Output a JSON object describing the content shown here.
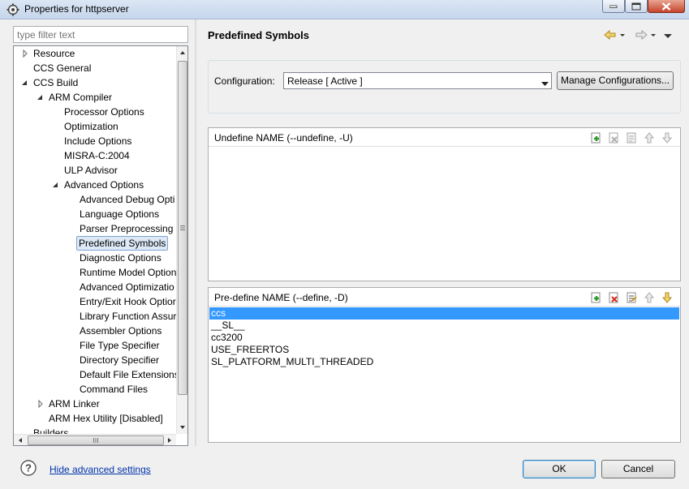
{
  "window": {
    "title": "Properties for httpserver",
    "icons": {
      "app": "properties-icon",
      "min": "minimize-icon",
      "max": "maximize-icon",
      "close": "close-icon"
    }
  },
  "filter": {
    "placeholder": "type filter text"
  },
  "tree": {
    "items": [
      {
        "label": "Resource",
        "expander": "collapsed"
      },
      {
        "label": "CCS General",
        "expander": "none"
      },
      {
        "label": "CCS Build",
        "expander": "expanded"
      },
      {
        "label": "ARM Compiler",
        "expander": "expanded"
      },
      {
        "label": "Processor Options",
        "expander": "none"
      },
      {
        "label": "Optimization",
        "expander": "none"
      },
      {
        "label": "Include Options",
        "expander": "none"
      },
      {
        "label": "MISRA-C:2004",
        "expander": "none"
      },
      {
        "label": "ULP Advisor",
        "expander": "none"
      },
      {
        "label": "Advanced Options",
        "expander": "expanded"
      },
      {
        "label": "Advanced Debug Opti",
        "expander": "none"
      },
      {
        "label": "Language Options",
        "expander": "none"
      },
      {
        "label": "Parser Preprocessing C",
        "expander": "none"
      },
      {
        "label": "Predefined Symbols",
        "expander": "none",
        "selected": true
      },
      {
        "label": "Diagnostic Options",
        "expander": "none"
      },
      {
        "label": "Runtime Model Option",
        "expander": "none"
      },
      {
        "label": "Advanced Optimizatio",
        "expander": "none"
      },
      {
        "label": "Entry/Exit Hook Optior",
        "expander": "none"
      },
      {
        "label": "Library Function Assur",
        "expander": "none"
      },
      {
        "label": "Assembler Options",
        "expander": "none"
      },
      {
        "label": "File Type Specifier",
        "expander": "none"
      },
      {
        "label": "Directory Specifier",
        "expander": "none"
      },
      {
        "label": "Default File Extensions",
        "expander": "none"
      },
      {
        "label": "Command Files",
        "expander": "none"
      },
      {
        "label": "ARM Linker",
        "expander": "collapsed"
      },
      {
        "label": "ARM Hex Utility  [Disabled]",
        "expander": "none"
      },
      {
        "label": "Builders",
        "expander": "none"
      }
    ]
  },
  "page": {
    "title": "Predefined Symbols",
    "nav": {
      "back": "back-arrow-icon",
      "forward": "forward-arrow-icon",
      "menu": "view-menu-icon"
    }
  },
  "configuration": {
    "label": "Configuration:",
    "selected": "Release  [ Active ]",
    "manage_label": "Manage Configurations..."
  },
  "undefine": {
    "title": "Undefine NAME (--undefine, -U)",
    "items": [],
    "tools": [
      "add-icon",
      "delete-icon",
      "edit-icon",
      "move-up-icon",
      "move-down-icon"
    ]
  },
  "predefine": {
    "title": "Pre-define NAME (--define, -D)",
    "items": [
      "ccs",
      "__SL__",
      "cc3200",
      "USE_FREERTOS",
      "SL_PLATFORM_MULTI_THREADED"
    ],
    "selected_index": 0,
    "tools": [
      "add-icon",
      "delete-icon",
      "edit-icon",
      "move-up-icon",
      "move-down-icon"
    ]
  },
  "footer": {
    "help_icon": "help-icon",
    "advanced_link": "Hide advanced settings",
    "ok_label": "OK",
    "cancel_label": "Cancel"
  }
}
